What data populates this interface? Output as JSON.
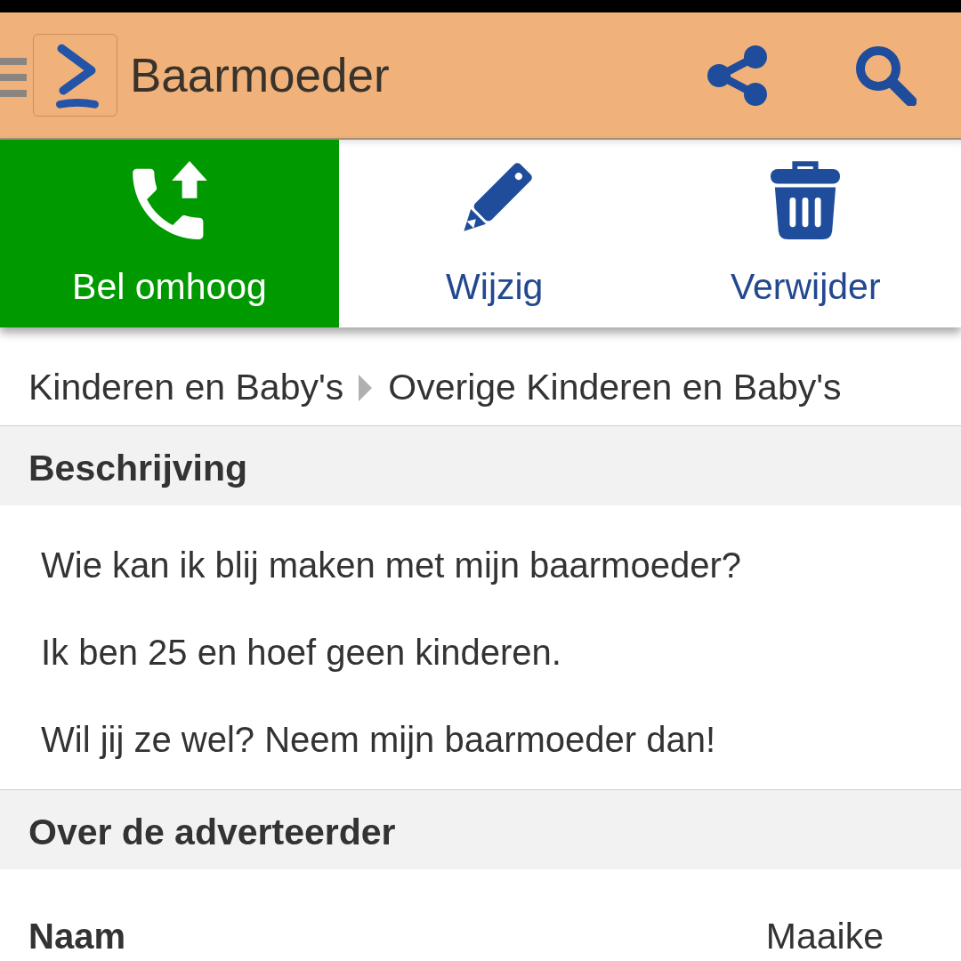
{
  "app_bar": {
    "title": "Baarmoeder"
  },
  "actions": [
    {
      "label": "Bel omhoog",
      "kind": "highlight"
    },
    {
      "label": "Wijzig",
      "kind": "plain"
    },
    {
      "label": "Verwijder",
      "kind": "plain"
    }
  ],
  "breadcrumb": [
    "Kinderen en Baby's",
    "Overige Kinderen en Baby's"
  ],
  "sections": [
    {
      "title": "Beschrijving",
      "paragraphs": [
        "Wie kan ik blij maken met mijn baarmoeder?",
        "Ik ben 25 en hoef geen kinderen.",
        "Wil jij ze wel? Neem mijn baarmoeder dan!"
      ]
    },
    {
      "title": "Over de adverteerder",
      "fields": [
        {
          "label": "Naam",
          "value": "Maaike"
        }
      ]
    }
  ]
}
